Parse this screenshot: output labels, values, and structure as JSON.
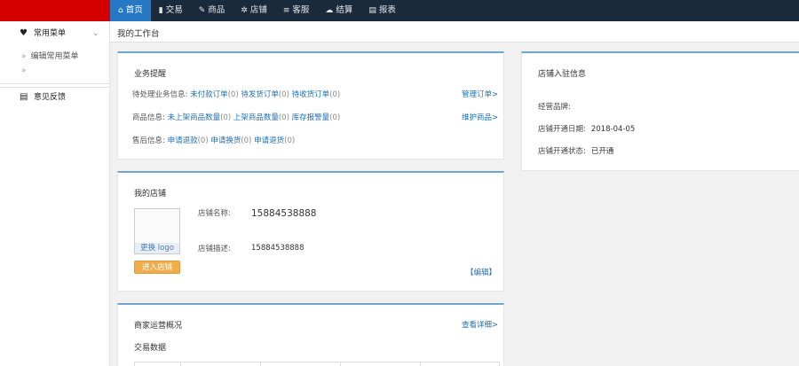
{
  "logo": {
    "alt_text": ""
  },
  "topnav": {
    "items": [
      {
        "label": "首页",
        "icon": "home-icon",
        "glyph": "⌂",
        "active": true
      },
      {
        "label": "交易",
        "icon": "bar-chart-icon",
        "glyph": "▮",
        "active": false
      },
      {
        "label": "商品",
        "icon": "edit-icon",
        "glyph": "✎",
        "active": false
      },
      {
        "label": "店铺",
        "icon": "gear-icon",
        "glyph": "✲",
        "active": false
      },
      {
        "label": "客服",
        "icon": "list-icon",
        "glyph": "≡",
        "active": false
      },
      {
        "label": "结算",
        "icon": "cloud-icon",
        "glyph": "☁",
        "active": false
      },
      {
        "label": "报表",
        "icon": "report-icon",
        "glyph": "▤",
        "active": false
      }
    ]
  },
  "sidebar": {
    "common_menu": {
      "label": "常用菜单",
      "icon": "heart-icon",
      "glyph": "♥",
      "chevron": "⌄"
    },
    "edit_common_menu": {
      "label": "编辑常用菜单",
      "arrow": "»"
    },
    "empty_item": {
      "arrow": "»"
    },
    "feedback": {
      "label": "意见反馈",
      "icon": "document-icon",
      "glyph": "▤"
    }
  },
  "breadcrumb": {
    "label": "我的工作台"
  },
  "business_card": {
    "title": "业务提醒",
    "pending": {
      "label": "待处理业务信息:",
      "items": [
        {
          "text": "未付款订单",
          "count": "(0)"
        },
        {
          "text": "待发货订单",
          "count": "(0)"
        },
        {
          "text": "待收货订单",
          "count": "(0)"
        }
      ],
      "action": "管理订单>"
    },
    "goods": {
      "label": "商品信息:",
      "items": [
        {
          "text": "未上架商品数量",
          "count": "(0)"
        },
        {
          "text": "上架商品数量",
          "count": "(0)"
        },
        {
          "text": "库存报警量",
          "count": "(0)"
        }
      ],
      "action": "维护商品>"
    },
    "aftersale": {
      "label": "售后信息:",
      "items": [
        {
          "text": "申请退款",
          "count": "(0)"
        },
        {
          "text": "申请换货",
          "count": "(0)"
        },
        {
          "text": "申请退货",
          "count": "(0)"
        }
      ]
    }
  },
  "store_card": {
    "title": "我的店铺",
    "change_logo": "更换 logo",
    "enter_store": "进入店铺",
    "name_label": "店铺名称:",
    "name_value": "15884538888",
    "desc_label": "店铺描述:",
    "desc_value": "15884538888",
    "edit": "【编辑】"
  },
  "ops_card": {
    "title": "商家运营概况",
    "detail": "查看详细>",
    "trade_data": "交易数据"
  },
  "entry_card": {
    "title": "店铺入驻信息",
    "brand_label": "经营品牌:",
    "brand_value": "",
    "open_date_label": "店铺开通日期:",
    "open_date_value": "2018-04-05",
    "status_label": "店铺开通状态:",
    "status_value": "已开通"
  }
}
